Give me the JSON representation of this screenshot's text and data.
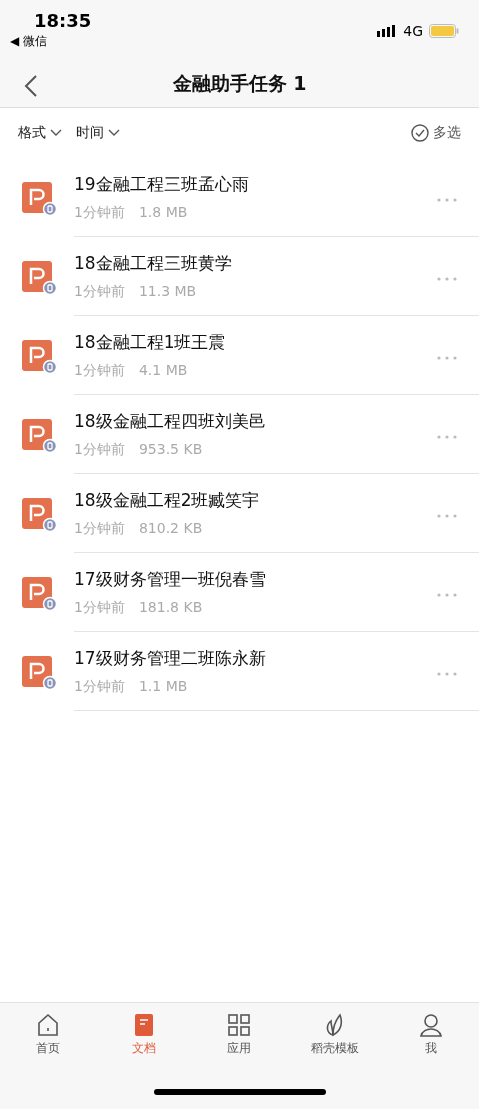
{
  "status_bar": {
    "time": "18:35",
    "back_app": "◀ 微信",
    "network": "4G"
  },
  "nav": {
    "title": "金融助手任务 1"
  },
  "filters": [
    {
      "label": "格式"
    },
    {
      "label": "时间"
    }
  ],
  "multi_select": {
    "label": "多选"
  },
  "files": [
    {
      "name": "19金融工程三班孟心雨",
      "time": "1分钟前",
      "size": "1.8 MB"
    },
    {
      "name": "18金融工程三班黄学",
      "time": "1分钟前",
      "size": "11.3 MB"
    },
    {
      "name": "18金融工程1班王震",
      "time": "1分钟前",
      "size": "4.1 MB"
    },
    {
      "name": "18级金融工程四班刘美邑",
      "time": "1分钟前",
      "size": "953.5 KB"
    },
    {
      "name": "18级金融工程2班臧笑宇",
      "time": "1分钟前",
      "size": "810.2 KB"
    },
    {
      "name": "17级财务管理一班倪春雪",
      "time": "1分钟前",
      "size": "181.8 KB"
    },
    {
      "name": "17级财务管理二班陈永新",
      "time": "1分钟前",
      "size": "1.1 MB"
    }
  ],
  "tabs": [
    {
      "kind": "home",
      "label": "首页",
      "selected": false
    },
    {
      "kind": "docs",
      "label": "文档",
      "selected": true
    },
    {
      "kind": "apps",
      "label": "应用",
      "selected": false
    },
    {
      "kind": "templates",
      "label": "稻壳模板",
      "selected": false
    },
    {
      "kind": "me",
      "label": "我",
      "selected": false
    }
  ]
}
